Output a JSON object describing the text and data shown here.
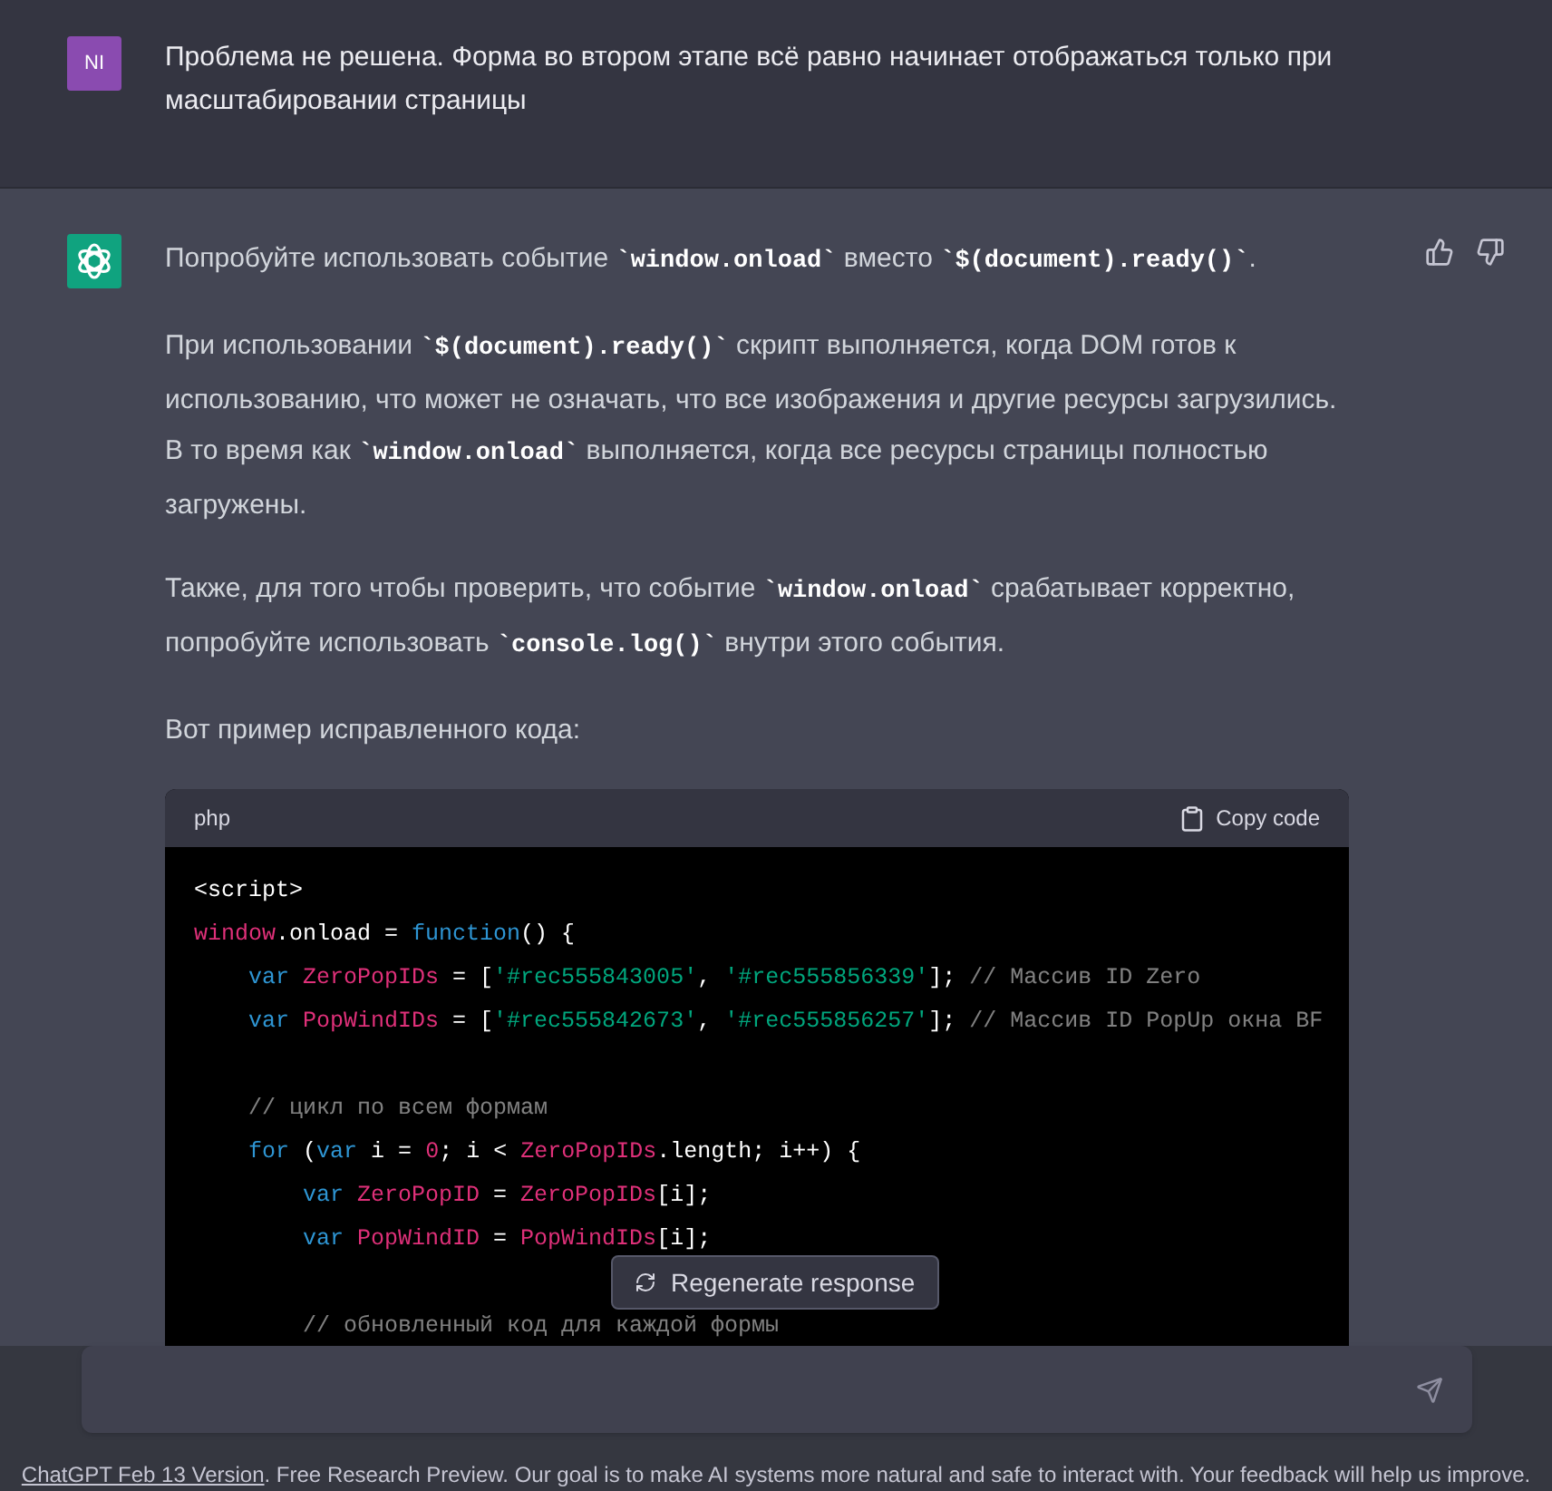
{
  "user_message": {
    "avatar": "NI",
    "text": "Проблема не решена. Форма во втором этапе всё равно начинает отображаться только при масштабировании страницы"
  },
  "assistant_message": {
    "paragraphs": [
      [
        {
          "kind": "text",
          "text": "Попробуйте использовать событие "
        },
        {
          "kind": "code",
          "text": "`window.onload`"
        },
        {
          "kind": "text",
          "text": " вместо "
        },
        {
          "kind": "code",
          "text": "`$(document).ready()`"
        },
        {
          "kind": "text",
          "text": "."
        }
      ],
      [
        {
          "kind": "text",
          "text": "При использовании "
        },
        {
          "kind": "code",
          "text": "`$(document).ready()`"
        },
        {
          "kind": "text",
          "text": " скрипт выполняется, когда DOM готов к использованию, что может не означать, что все изображения и другие ресурсы загрузились. В то время как "
        },
        {
          "kind": "code",
          "text": "`window.onload`"
        },
        {
          "kind": "text",
          "text": " выполняется, когда все ресурсы страницы полностью загружены."
        }
      ],
      [
        {
          "kind": "text",
          "text": "Также, для того чтобы проверить, что событие "
        },
        {
          "kind": "code",
          "text": "`window.onload`"
        },
        {
          "kind": "text",
          "text": " срабатывает корректно, попробуйте использовать "
        },
        {
          "kind": "code",
          "text": "`console.log()`"
        },
        {
          "kind": "text",
          "text": " внутри этого события."
        }
      ],
      [
        {
          "kind": "text",
          "text": "Вот пример исправленного кода:"
        }
      ]
    ],
    "code_block": {
      "language": "php",
      "copy_label": "Copy code",
      "lines": [
        {
          "kind": "code",
          "tokens": [
            {
              "kind": "plain",
              "text": "<script>"
            }
          ]
        },
        {
          "kind": "code",
          "tokens": [
            {
              "kind": "var",
              "text": "window"
            },
            {
              "kind": "plain",
              "text": ".onload = "
            },
            {
              "kind": "keyword",
              "text": "function"
            },
            {
              "kind": "plain",
              "text": "() {"
            }
          ]
        },
        {
          "kind": "code",
          "tokens": [
            {
              "kind": "keyword",
              "text": "    var "
            },
            {
              "kind": "var",
              "text": "ZeroPopIDs"
            },
            {
              "kind": "plain",
              "text": " = ["
            },
            {
              "kind": "string",
              "text": "'#rec555843005'"
            },
            {
              "kind": "plain",
              "text": ", "
            },
            {
              "kind": "string",
              "text": "'#rec555856339'"
            },
            {
              "kind": "plain",
              "text": "]; "
            },
            {
              "kind": "comment",
              "text": "// Массив ID Zero"
            }
          ]
        },
        {
          "kind": "code",
          "tokens": [
            {
              "kind": "keyword",
              "text": "    var "
            },
            {
              "kind": "var",
              "text": "PopWindIDs"
            },
            {
              "kind": "plain",
              "text": " = ["
            },
            {
              "kind": "string",
              "text": "'#rec555842673'"
            },
            {
              "kind": "plain",
              "text": ", "
            },
            {
              "kind": "string",
              "text": "'#rec555856257'"
            },
            {
              "kind": "plain",
              "text": "]; "
            },
            {
              "kind": "comment",
              "text": "// Массив ID PopUp окна BF"
            }
          ]
        },
        {
          "kind": "blank"
        },
        {
          "kind": "code",
          "tokens": [
            {
              "kind": "comment",
              "text": "    // цикл по всем формам"
            }
          ]
        },
        {
          "kind": "code",
          "tokens": [
            {
              "kind": "keyword",
              "text": "    for"
            },
            {
              "kind": "plain",
              "text": " ("
            },
            {
              "kind": "keyword",
              "text": "var"
            },
            {
              "kind": "plain",
              "text": " i = "
            },
            {
              "kind": "var",
              "text": "0"
            },
            {
              "kind": "plain",
              "text": "; i < "
            },
            {
              "kind": "var",
              "text": "ZeroPopIDs"
            },
            {
              "kind": "plain",
              "text": ".length; i++) {"
            }
          ]
        },
        {
          "kind": "code",
          "tokens": [
            {
              "kind": "keyword",
              "text": "        var "
            },
            {
              "kind": "var",
              "text": "ZeroPopID"
            },
            {
              "kind": "plain",
              "text": " = "
            },
            {
              "kind": "var",
              "text": "ZeroPopIDs"
            },
            {
              "kind": "plain",
              "text": "[i];"
            }
          ]
        },
        {
          "kind": "code",
          "tokens": [
            {
              "kind": "keyword",
              "text": "        var "
            },
            {
              "kind": "var",
              "text": "PopWindID"
            },
            {
              "kind": "plain",
              "text": " = "
            },
            {
              "kind": "var",
              "text": "PopWindIDs"
            },
            {
              "kind": "plain",
              "text": "[i];"
            }
          ]
        },
        {
          "kind": "blank"
        },
        {
          "kind": "code",
          "tokens": [
            {
              "kind": "comment",
              "text": "        // обновленный код для каждой формы"
            }
          ]
        }
      ]
    }
  },
  "regenerate_button": "Regenerate response",
  "footer": {
    "link": "ChatGPT Feb 13 Version",
    "text": ". Free Research Preview. Our goal is to make AI systems more natural and safe to interact with. Your feedback will help us improve."
  }
}
